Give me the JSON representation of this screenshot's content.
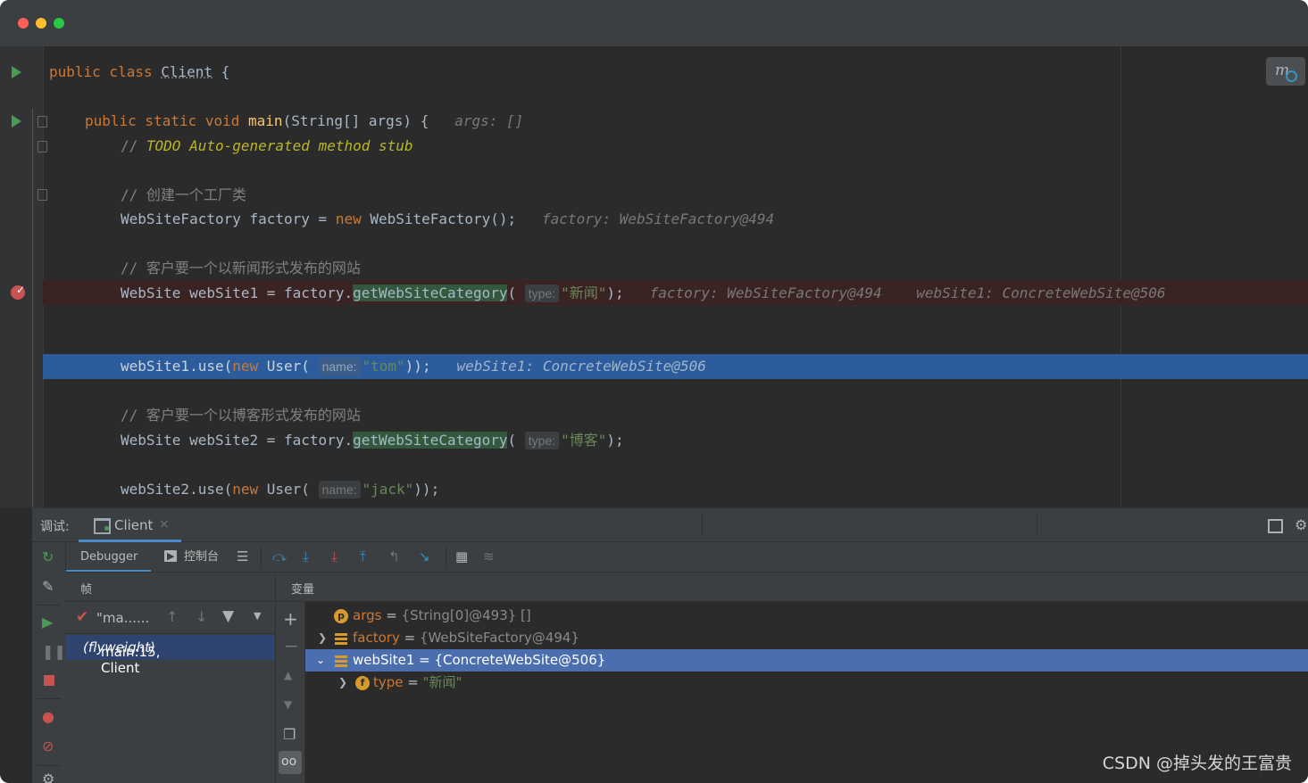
{
  "editor": {
    "line1": {
      "kw": "public class ",
      "name": "Client",
      "rest": " {"
    },
    "line2": {
      "kw": "public static void ",
      "fn": "main",
      "sig": "(String[] args) {",
      "hint": "args: []"
    },
    "line3": {
      "prefix": "// ",
      "todo": "TODO Auto-generated method stub"
    },
    "line4": {
      "comment": "// 创建一个工厂类"
    },
    "line5": {
      "code": "WebSiteFactory factory = ",
      "kw": "new",
      "rest": " WebSiteFactory();",
      "hint": "factory: WebSiteFactory@494"
    },
    "line6": {
      "comment": "// 客户要一个以新闻形式发布的网站"
    },
    "line7": {
      "code": "WebSite webSite1 = factory.",
      "method": "getWebSiteCategory",
      "paren": "(",
      "param": "type:",
      "arg": "\"新闻\"",
      "close": ");",
      "hint1": "factory: WebSiteFactory@494",
      "hint2": "webSite1: ConcreteWebSite@506"
    },
    "line8": {
      "code": "webSite1.use(",
      "kw": "new",
      "rest": " User(",
      "param": "name:",
      "arg": "\"tom\"",
      "close": "));",
      "hint": "webSite1: ConcreteWebSite@506"
    },
    "line9": {
      "comment": "// 客户要一个以博客形式发布的网站"
    },
    "line10": {
      "code": "WebSite webSite2 = factory.",
      "method": "getWebSiteCategory",
      "paren": "(",
      "param": "type:",
      "arg": "\"博客\"",
      "close": ");"
    },
    "line11": {
      "code": "webSite2.use(",
      "kw": "new",
      "rest": " User(",
      "param": "name:",
      "arg": "\"jack\"",
      "close": "));"
    }
  },
  "debug": {
    "label": "调试:",
    "tab": "Client",
    "tab_close": "×",
    "subtabs": {
      "debugger": "Debugger",
      "console": "控制台"
    },
    "frames_header": "帧",
    "thread": "\"ma......",
    "frame_main": "main:15, Client ",
    "frame_pkg": "(flyweight)",
    "vars_header": "变量",
    "variables": [
      {
        "name": "args",
        "eq": " = ",
        "value": "{String[0]@493} []"
      },
      {
        "name": "factory",
        "eq": " = ",
        "value": "{WebSiteFactory@494}"
      },
      {
        "name": "webSite1",
        "eq": " = ",
        "value": "{ConcreteWebSite@506}"
      },
      {
        "name": "type",
        "eq": " = ",
        "value": "\"新闻\""
      }
    ]
  },
  "watermark": "CSDN @掉头发的王富贵"
}
